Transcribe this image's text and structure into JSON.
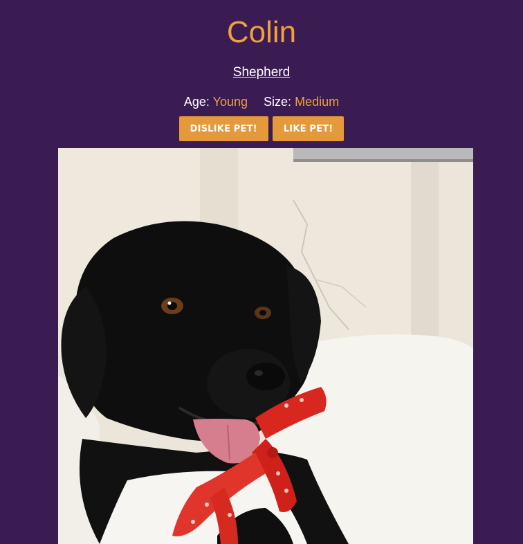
{
  "pet": {
    "name": "Colin",
    "breed": "Shepherd",
    "age_label": "Age:",
    "age": "Young",
    "size_label": "Size:",
    "size": "Medium"
  },
  "actions": {
    "dislike_label": "DISLIKE PET!",
    "like_label": "LIKE PET!"
  },
  "colors": {
    "background": "#3b1c52",
    "accent": "#f0a03c",
    "button": "#e4993a"
  }
}
